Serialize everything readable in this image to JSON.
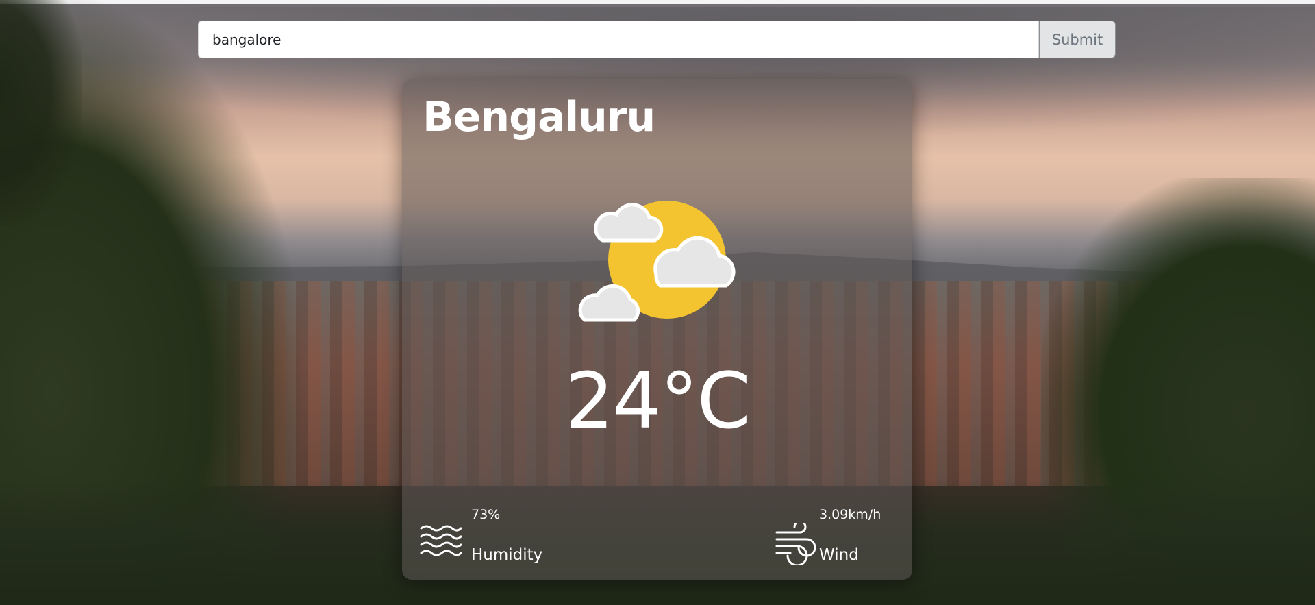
{
  "search": {
    "value": "bangalore",
    "placeholder": "",
    "submit_label": "Submit"
  },
  "weather": {
    "city": "Bengaluru",
    "icon": "partly-cloudy-icon",
    "temperature": "24°C",
    "humidity": {
      "value": "73%",
      "label": "Humidity",
      "icon": "waves-icon"
    },
    "wind": {
      "value": "3.09km/h",
      "label": "Wind",
      "icon": "wind-icon"
    }
  },
  "colors": {
    "sun": "#f4c430",
    "card_text": "#ffffff",
    "submit_text": "#6c757d"
  }
}
